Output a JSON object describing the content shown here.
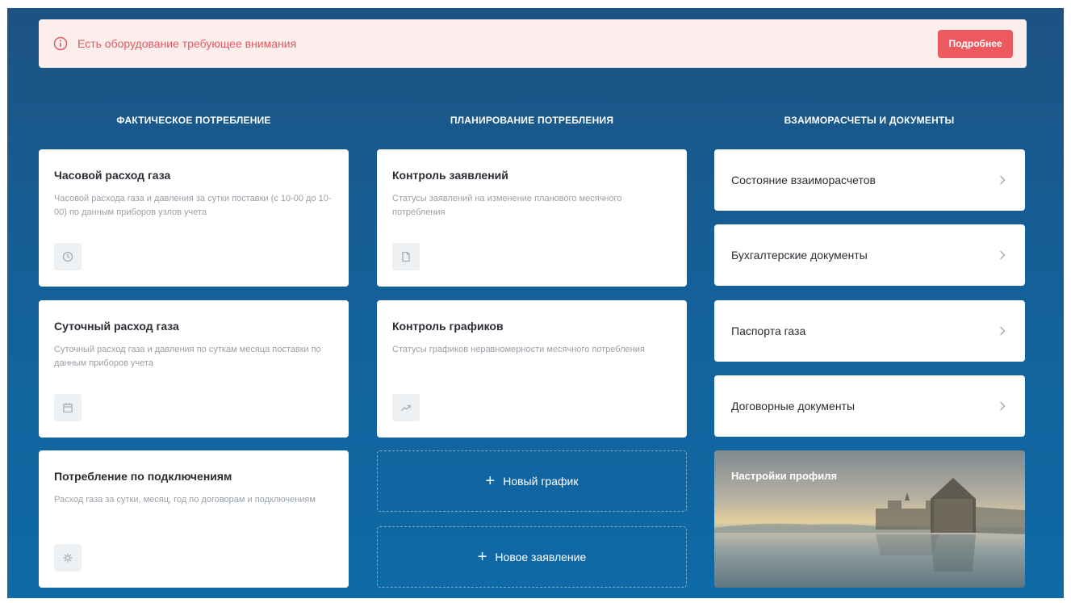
{
  "alert": {
    "message": "Есть оборудование требующее внимания",
    "button_label": "Подробнее",
    "color": "#ec5a60"
  },
  "columns": {
    "actual": "ФАКТИЧЕСКОЕ ПОТРЕБЛЕНИЕ",
    "planning": "ПЛАНИРОВАНИЕ ПОТРЕБЛЕНИЯ",
    "settlements": "ВЗАИМОРАСЧЕТЫ И ДОКУМЕНТЫ"
  },
  "actual_cards": [
    {
      "title": "Часовой расход газа",
      "desc": "Часовой расхода газа и давления за сутки поставки (с 10-00 до 10-00) по данным приборов узлов учета",
      "icon": "clock-icon"
    },
    {
      "title": "Суточный расход газа",
      "desc": "Суточный расход газа и давления по суткам месяца поставки по данным приборов учета",
      "icon": "calendar-icon"
    },
    {
      "title": "Потребление по подключениям",
      "desc": "Расход газа за сутки, месяц, год по договорам и подключениям",
      "icon": "connection-icon"
    }
  ],
  "planning_cards": [
    {
      "title": "Контроль заявлений",
      "desc": "Статусы заявлений на изменение планового месячного потребления",
      "icon": "document-icon"
    },
    {
      "title": "Контроль графиков",
      "desc": "Статусы графиков неравномерности месячного потребления",
      "icon": "trend-icon"
    }
  ],
  "planning_actions": {
    "new_schedule": "Новый график",
    "new_application": "Новое заявление"
  },
  "settlement_links": [
    {
      "label": "Состояние взаиморасчетов"
    },
    {
      "label": "Бухгалтерские документы"
    },
    {
      "label": "Паспорта газа"
    },
    {
      "label": "Договорные документы"
    }
  ],
  "profile": {
    "label": "Настройки профиля"
  }
}
